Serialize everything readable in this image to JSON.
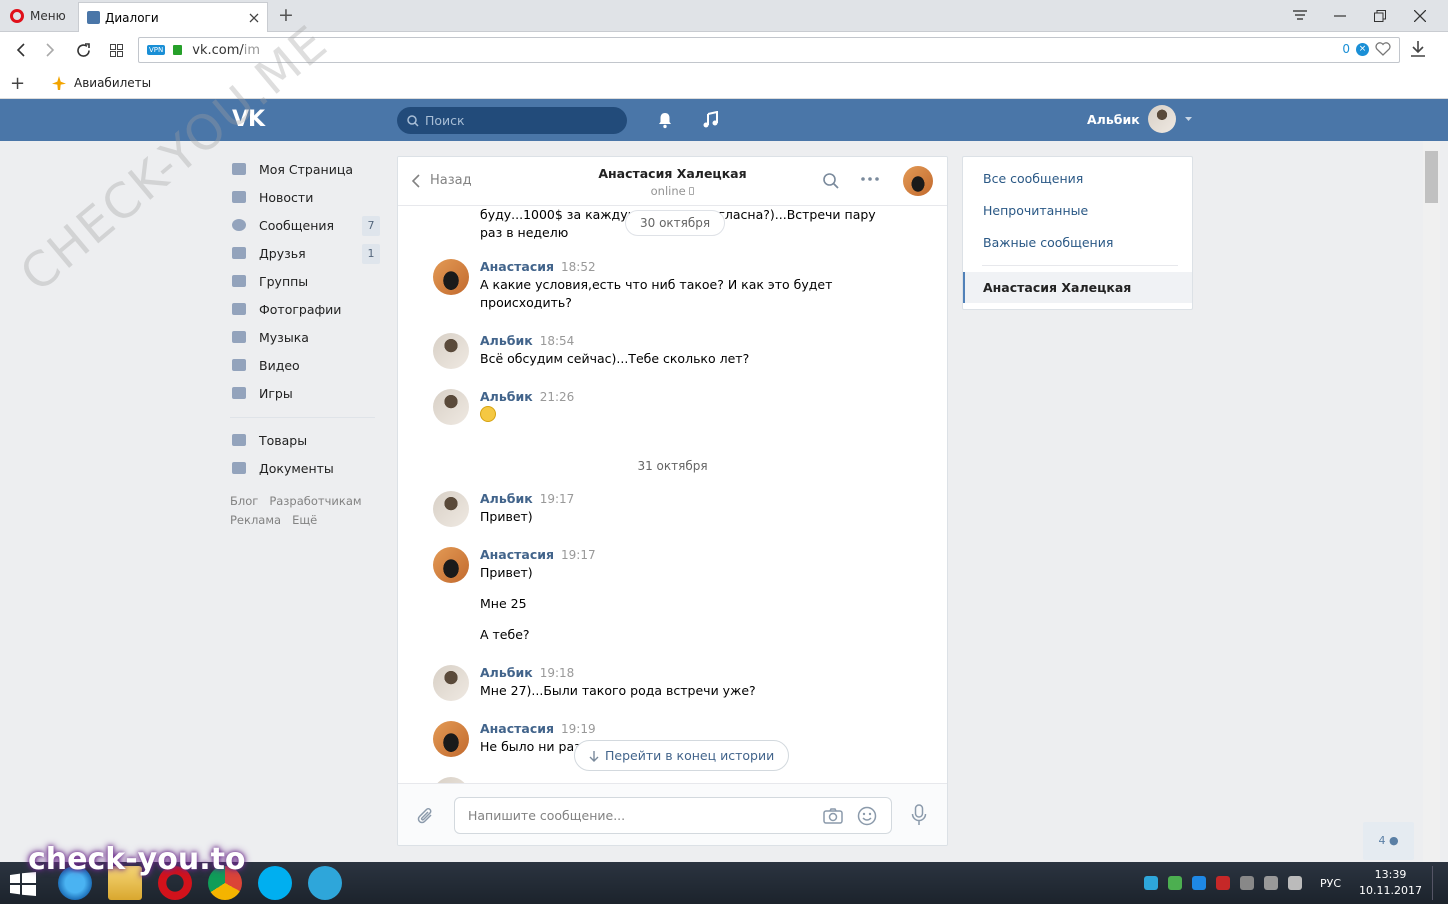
{
  "browser": {
    "menu_label": "Меню",
    "tab_title": "Диалоги",
    "url_host": "vk.com/",
    "url_path": "im",
    "vpn_label": "VPN",
    "blocked_count": "0",
    "bookmark_label": "Авиабилеты"
  },
  "vk_header": {
    "logo": "VK",
    "search_placeholder": "Поиск",
    "user_name": "Альбик"
  },
  "left_nav": {
    "items": [
      {
        "label": "Моя Страница",
        "icon": "home-icon"
      },
      {
        "label": "Новости",
        "icon": "news-icon"
      },
      {
        "label": "Сообщения",
        "icon": "messages-icon",
        "count": "7"
      },
      {
        "label": "Друзья",
        "icon": "friends-icon",
        "count": "1"
      },
      {
        "label": "Группы",
        "icon": "groups-icon"
      },
      {
        "label": "Фотографии",
        "icon": "camera-icon"
      },
      {
        "label": "Музыка",
        "icon": "music-icon"
      },
      {
        "label": "Видео",
        "icon": "video-icon"
      },
      {
        "label": "Игры",
        "icon": "games-icon"
      },
      {
        "label": "Товары",
        "icon": "bag-icon"
      },
      {
        "label": "Документы",
        "icon": "document-icon"
      }
    ],
    "footer": [
      "Блог",
      "Разработчикам",
      "Реклама",
      "Ещё"
    ]
  },
  "chat": {
    "back_label": "Назад",
    "peer_name": "Анастасия Халецкая",
    "peer_status": "online",
    "messages": [
      {
        "author": "",
        "time": "",
        "text": "буду...1000$ за каждую встречу. Согласна?)...Встречи пару раз в неделю"
      },
      {
        "author": "Анастасия",
        "time": "18:52",
        "text": "А какие условия,есть что ниб такое? И как это будет происходить?"
      },
      {
        "author": "Альбик",
        "time": "18:54",
        "text": "Всё обсудим сейчас)...Тебе сколько лет?"
      },
      {
        "author": "Альбик",
        "time": "21:26",
        "text": ""
      },
      {
        "author": "Альбик",
        "time": "19:17",
        "text": "Привет)"
      },
      {
        "author": "Анастасия",
        "time": "19:17",
        "text": "Привет)",
        "extra": [
          "Мне 25",
          "А тебе?"
        ]
      },
      {
        "author": "Альбик",
        "time": "19:18",
        "text": "Мне 27)...Были такого рода встречи уже?"
      },
      {
        "author": "Анастасия",
        "time": "19:19",
        "text": "Не было ни разу"
      }
    ],
    "date_pill": "30 октября",
    "date_separator": "31 октября",
    "jump_label": "Перейти в конец истории",
    "compose_placeholder": "Напишите сообщение..."
  },
  "side_panel": {
    "items": [
      "Все сообщения",
      "Непрочитанные",
      "Важные сообщения"
    ],
    "active": "Анастасия Халецкая"
  },
  "fab_count": "4",
  "watermarks": {
    "diagonal": "CHECK-YOU.ME",
    "bottom": "check-you.to"
  },
  "taskbar": {
    "lang": "РУС",
    "time": "13:39",
    "date": "10.11.2017"
  }
}
